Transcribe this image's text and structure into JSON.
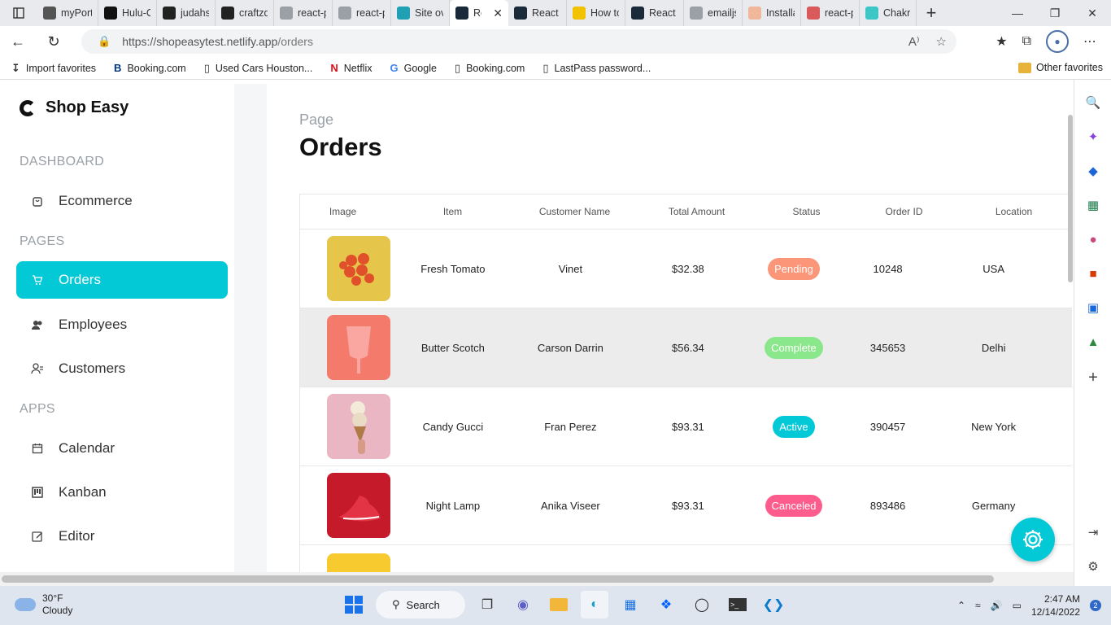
{
  "browser": {
    "tabs": [
      {
        "title": "myPort",
        "icon": "github-icon",
        "color": "#555555"
      },
      {
        "title": "Hulu-C",
        "icon": "vercel-icon",
        "color": "#111111"
      },
      {
        "title": "judahs",
        "icon": "github-icon",
        "color": "#222222"
      },
      {
        "title": "craftzd",
        "icon": "github-icon",
        "color": "#222222"
      },
      {
        "title": "react-p",
        "icon": "search-icon",
        "color": "#9aa0a6"
      },
      {
        "title": "react-p",
        "icon": "search-icon",
        "color": "#9aa0a6"
      },
      {
        "title": "Site ov",
        "icon": "netlify-icon",
        "color": "#20a0b5"
      },
      {
        "title": "Re",
        "icon": "react-icon",
        "color": "#1b2a3a",
        "active": true
      },
      {
        "title": "React A",
        "icon": "react-icon",
        "color": "#1b2a3a"
      },
      {
        "title": "How to",
        "icon": "w3-icon",
        "color": "#f2c200"
      },
      {
        "title": "React A",
        "icon": "react-icon",
        "color": "#1b2a3a"
      },
      {
        "title": "emailjs",
        "icon": "search-icon",
        "color": "#9aa0a6"
      },
      {
        "title": "Installa",
        "icon": "install-icon",
        "color": "#f0b79a"
      },
      {
        "title": "react-p",
        "icon": "gitpod-icon",
        "color": "#d95a5a"
      },
      {
        "title": "Chakra",
        "icon": "chakra-icon",
        "color": "#3cc6c6"
      }
    ],
    "url_prefix": "https://shopeasytest.netlify.app",
    "url_path": "/orders",
    "bookmarks": [
      {
        "label": "Import favorites",
        "icon": "import-icon"
      },
      {
        "label": "Booking.com",
        "icon": "booking-icon"
      },
      {
        "label": "Used Cars Houston...",
        "icon": "page-icon"
      },
      {
        "label": "Netflix",
        "icon": "netflix-icon"
      },
      {
        "label": "Google",
        "icon": "google-icon"
      },
      {
        "label": "Booking.com",
        "icon": "page-icon"
      },
      {
        "label": "LastPass password...",
        "icon": "page-icon"
      }
    ],
    "other_favorites": "Other favorites"
  },
  "sidebar": {
    "brand": "Shop Easy",
    "sections": {
      "dashboard": "DASHBOARD",
      "pages": "PAGES",
      "apps": "APPS"
    },
    "items": {
      "ecommerce": "Ecommerce",
      "orders": "Orders",
      "employees": "Employees",
      "customers": "Customers",
      "calendar": "Calendar",
      "kanban": "Kanban",
      "editor": "Editor"
    }
  },
  "main": {
    "breadcrumb": "Page",
    "title": "Orders",
    "columns": {
      "image": "Image",
      "item": "Item",
      "customer": "Customer Name",
      "amount": "Total Amount",
      "status": "Status",
      "order_id": "Order ID",
      "location": "Location"
    },
    "rows": [
      {
        "item": "Fresh Tomato",
        "customer": "Vinet",
        "amount": "$32.38",
        "status": "Pending",
        "status_color": "#fb9678",
        "order_id": "10248",
        "location": "USA"
      },
      {
        "item": "Butter Scotch",
        "customer": "Carson Darrin",
        "amount": "$56.34",
        "status": "Complete",
        "status_color": "#8be78b",
        "order_id": "345653",
        "location": "Delhi"
      },
      {
        "item": "Candy Gucci",
        "customer": "Fran Perez",
        "amount": "$93.31",
        "status": "Active",
        "status_color": "#03c9d7",
        "order_id": "390457",
        "location": "New York"
      },
      {
        "item": "Night Lamp",
        "customer": "Anika Viseer",
        "amount": "$93.31",
        "status": "Canceled",
        "status_color": "#ff5c8e",
        "order_id": "893486",
        "location": "Germany"
      }
    ],
    "accent_color": "#03c9d7"
  },
  "taskbar": {
    "temperature": "30°F",
    "condition": "Cloudy",
    "search_label": "Search",
    "time": "2:47 AM",
    "date": "12/14/2022",
    "notifications": "2"
  }
}
